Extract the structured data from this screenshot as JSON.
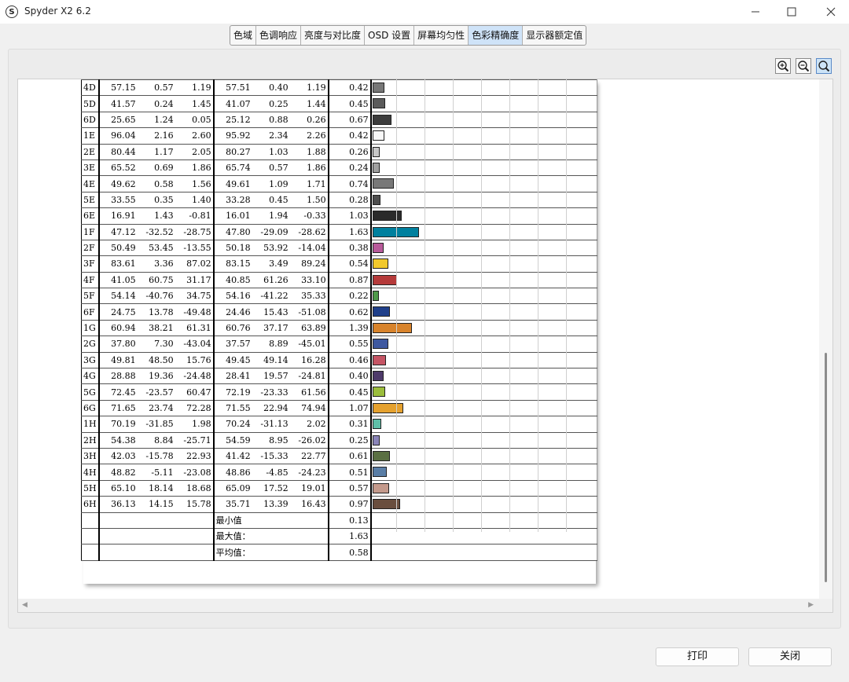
{
  "window": {
    "title": "Spyder X2 6.2",
    "app_icon": "S"
  },
  "tabs": [
    {
      "label": "色域"
    },
    {
      "label": "色调响应"
    },
    {
      "label": "亮度与对比度"
    },
    {
      "label": "OSD 设置"
    },
    {
      "label": "屏幕均匀性"
    },
    {
      "label": "色彩精确度",
      "active": true
    },
    {
      "label": "显示器额定值"
    }
  ],
  "zoom_tools": [
    "zoom-in-icon",
    "zoom-out-icon",
    "zoom-fit-icon"
  ],
  "report": {
    "rows": [
      {
        "id": "4D",
        "m": [
          "57.15",
          "0.57",
          "1.19"
        ],
        "r": [
          "57.51",
          "0.40",
          "1.19"
        ],
        "de": "0.42",
        "de_val": 0.42,
        "color": "#777777"
      },
      {
        "id": "5D",
        "m": [
          "41.57",
          "0.24",
          "1.45"
        ],
        "r": [
          "41.07",
          "0.25",
          "1.44"
        ],
        "de": "0.45",
        "de_val": 0.45,
        "color": "#5b5b5b"
      },
      {
        "id": "6D",
        "m": [
          "25.65",
          "1.24",
          "0.05"
        ],
        "r": [
          "25.12",
          "0.88",
          "0.26"
        ],
        "de": "0.67",
        "de_val": 0.67,
        "color": "#3c3c3c"
      },
      {
        "id": "1E",
        "m": [
          "96.04",
          "2.16",
          "2.60"
        ],
        "r": [
          "95.92",
          "2.34",
          "2.26"
        ],
        "de": "0.42",
        "de_val": 0.42,
        "color": "#f8f8f8"
      },
      {
        "id": "2E",
        "m": [
          "80.44",
          "1.17",
          "2.05"
        ],
        "r": [
          "80.27",
          "1.03",
          "1.88"
        ],
        "de": "0.26",
        "de_val": 0.26,
        "color": "#c7c7c7"
      },
      {
        "id": "3E",
        "m": [
          "65.52",
          "0.69",
          "1.86"
        ],
        "r": [
          "65.74",
          "0.57",
          "1.86"
        ],
        "de": "0.24",
        "de_val": 0.24,
        "color": "#a0a0a0"
      },
      {
        "id": "4E",
        "m": [
          "49.62",
          "0.58",
          "1.56"
        ],
        "r": [
          "49.61",
          "1.09",
          "1.71"
        ],
        "de": "0.74",
        "de_val": 0.74,
        "color": "#787878"
      },
      {
        "id": "5E",
        "m": [
          "33.55",
          "0.35",
          "1.40"
        ],
        "r": [
          "33.28",
          "0.45",
          "1.50"
        ],
        "de": "0.28",
        "de_val": 0.28,
        "color": "#4e4e4e"
      },
      {
        "id": "6E",
        "m": [
          "16.91",
          "1.43",
          "-0.81"
        ],
        "r": [
          "16.01",
          "1.94",
          "-0.33"
        ],
        "de": "1.03",
        "de_val": 1.03,
        "color": "#2a2a2a"
      },
      {
        "id": "1F",
        "m": [
          "47.12",
          "-32.52",
          "-28.75"
        ],
        "r": [
          "47.80",
          "-29.09",
          "-28.62"
        ],
        "de": "1.63",
        "de_val": 1.63,
        "color": "#00809e"
      },
      {
        "id": "2F",
        "m": [
          "50.49",
          "53.45",
          "-13.55"
        ],
        "r": [
          "50.18",
          "53.92",
          "-14.04"
        ],
        "de": "0.38",
        "de_val": 0.38,
        "color": "#b85a9a"
      },
      {
        "id": "3F",
        "m": [
          "83.61",
          "3.36",
          "87.02"
        ],
        "r": [
          "83.15",
          "3.49",
          "89.24"
        ],
        "de": "0.54",
        "de_val": 0.54,
        "color": "#f2c92c"
      },
      {
        "id": "4F",
        "m": [
          "41.05",
          "60.75",
          "31.17"
        ],
        "r": [
          "40.85",
          "61.26",
          "33.10"
        ],
        "de": "0.87",
        "de_val": 0.87,
        "color": "#b53a3a"
      },
      {
        "id": "5F",
        "m": [
          "54.14",
          "-40.76",
          "34.75"
        ],
        "r": [
          "54.16",
          "-41.22",
          "35.33"
        ],
        "de": "0.22",
        "de_val": 0.22,
        "color": "#4f9a4a"
      },
      {
        "id": "6F",
        "m": [
          "24.75",
          "13.78",
          "-49.48"
        ],
        "r": [
          "24.46",
          "15.43",
          "-51.08"
        ],
        "de": "0.62",
        "de_val": 0.62,
        "color": "#1f3f8a"
      },
      {
        "id": "1G",
        "m": [
          "60.94",
          "38.21",
          "61.31"
        ],
        "r": [
          "60.76",
          "37.17",
          "63.89"
        ],
        "de": "1.39",
        "de_val": 1.39,
        "color": "#d8832b"
      },
      {
        "id": "2G",
        "m": [
          "37.80",
          "7.30",
          "-43.04"
        ],
        "r": [
          "37.57",
          "8.89",
          "-45.01"
        ],
        "de": "0.55",
        "de_val": 0.55,
        "color": "#3e58a0"
      },
      {
        "id": "3G",
        "m": [
          "49.81",
          "48.50",
          "15.76"
        ],
        "r": [
          "49.45",
          "49.14",
          "16.28"
        ],
        "de": "0.46",
        "de_val": 0.46,
        "color": "#c55464"
      },
      {
        "id": "4G",
        "m": [
          "28.88",
          "19.36",
          "-24.48"
        ],
        "r": [
          "28.41",
          "19.57",
          "-24.81"
        ],
        "de": "0.40",
        "de_val": 0.4,
        "color": "#4e3a6a"
      },
      {
        "id": "5G",
        "m": [
          "72.45",
          "-23.57",
          "60.47"
        ],
        "r": [
          "72.19",
          "-23.33",
          "61.56"
        ],
        "de": "0.45",
        "de_val": 0.45,
        "color": "#9bbd3c"
      },
      {
        "id": "6G",
        "m": [
          "71.65",
          "23.74",
          "72.28"
        ],
        "r": [
          "71.55",
          "22.94",
          "74.94"
        ],
        "de": "1.07",
        "de_val": 1.07,
        "color": "#e5a12e"
      },
      {
        "id": "1H",
        "m": [
          "70.19",
          "-31.85",
          "1.98"
        ],
        "r": [
          "70.24",
          "-31.13",
          "2.02"
        ],
        "de": "0.31",
        "de_val": 0.31,
        "color": "#5fbfa8"
      },
      {
        "id": "2H",
        "m": [
          "54.38",
          "8.84",
          "-25.71"
        ],
        "r": [
          "54.59",
          "8.95",
          "-26.02"
        ],
        "de": "0.25",
        "de_val": 0.25,
        "color": "#8a84b8"
      },
      {
        "id": "3H",
        "m": [
          "42.03",
          "-15.78",
          "22.93"
        ],
        "r": [
          "41.42",
          "-15.33",
          "22.77"
        ],
        "de": "0.61",
        "de_val": 0.61,
        "color": "#5a6f42"
      },
      {
        "id": "4H",
        "m": [
          "48.82",
          "-5.11",
          "-23.08"
        ],
        "r": [
          "48.86",
          "-4.85",
          "-24.23"
        ],
        "de": "0.51",
        "de_val": 0.51,
        "color": "#5a7ea6"
      },
      {
        "id": "5H",
        "m": [
          "65.10",
          "18.14",
          "18.68"
        ],
        "r": [
          "65.09",
          "17.52",
          "19.01"
        ],
        "de": "0.57",
        "de_val": 0.57,
        "color": "#c49a8c"
      },
      {
        "id": "6H",
        "m": [
          "36.13",
          "14.15",
          "15.78"
        ],
        "r": [
          "35.71",
          "13.39",
          "16.43"
        ],
        "de": "0.97",
        "de_val": 0.97,
        "color": "#6a4e3e"
      }
    ],
    "summary": [
      {
        "label": "最小值",
        "value": "0.13"
      },
      {
        "label": "最大值：",
        "value": "1.63"
      },
      {
        "label": "平均值：",
        "value": "0.58"
      }
    ]
  },
  "buttons": {
    "print": "打印",
    "close": "关闭"
  },
  "window_controls": {
    "minimize": "—",
    "maximize": "☐",
    "close": "✕"
  }
}
